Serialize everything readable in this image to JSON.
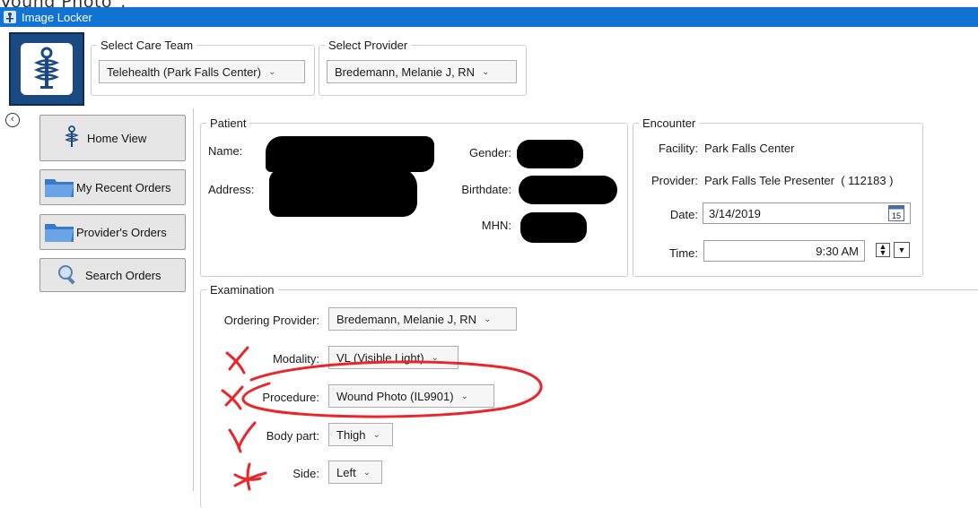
{
  "top_caption": "Vound Photo\".",
  "window": {
    "title": "Image Locker"
  },
  "care_team": {
    "legend": "Select Care Team",
    "value": "Telehealth (Park Falls Center)"
  },
  "provider_select": {
    "legend": "Select Provider",
    "value": "Bredemann, Melanie J, RN"
  },
  "sidebar": {
    "back_icon": "chevron-left-icon",
    "buttons": [
      {
        "label": "Home View",
        "icon": "caduceus-icon"
      },
      {
        "label": "My Recent Orders",
        "icon": "folder-icon"
      },
      {
        "label": "Provider's Orders",
        "icon": "folder-icon"
      },
      {
        "label": "Search Orders",
        "icon": "magnifier-icon"
      }
    ]
  },
  "patient": {
    "legend": "Patient",
    "name_label": "Name:",
    "address_label": "Address:",
    "gender_label": "Gender:",
    "birthdate_label": "Birthdate:",
    "mhn_label": "MHN:"
  },
  "encounter": {
    "legend": "Encounter",
    "facility_label": "Facility:",
    "facility_value": "Park Falls Center",
    "provider_label": "Provider:",
    "provider_value": "Park Falls Tele Presenter  ( 112183 )",
    "date_label": "Date:",
    "date_value": "3/14/2019",
    "calendar_day": "15",
    "time_label": "Time:",
    "time_value": "9:30 AM"
  },
  "examination": {
    "legend": "Examination",
    "ordering_provider_label": "Ordering Provider:",
    "ordering_provider_value": "Bredemann, Melanie J, RN",
    "modality_label": "Modality:",
    "modality_value": "VL (Visible Light)",
    "procedure_label": "Procedure:",
    "procedure_value": "Wound Photo (IL9901)",
    "body_part_label": "Body part:",
    "body_part_value": "Thigh",
    "side_label": "Side:",
    "side_value": "Left"
  },
  "annotation_color": "#e8262b",
  "title_bar_color": "#1173d4"
}
